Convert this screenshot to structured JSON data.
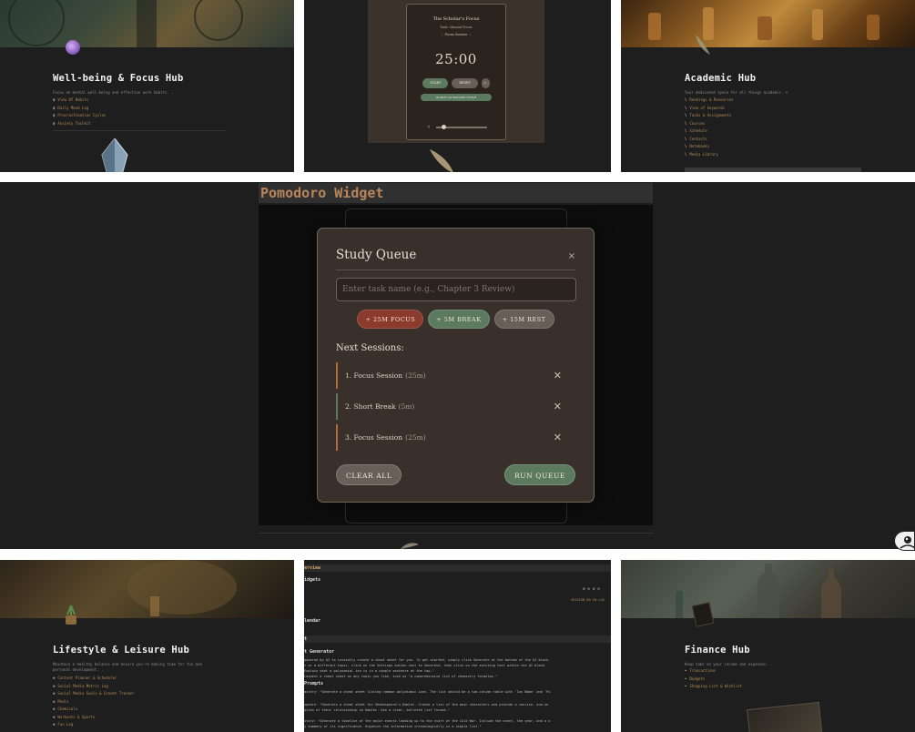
{
  "hubs": {
    "wellbeing": {
      "title": "Well-being & Focus Hub",
      "desc": "Focus on mental well-being and effective work habits. .",
      "items": [
        "View Of Habits",
        "Daily Mood Log",
        "Procrastination Cycles",
        "Anxiety Toolkit"
      ]
    },
    "academic": {
      "title": "Academic Hub",
      "desc": "Your dedicated space for all things academic. ☺",
      "items": [
        "Readings & Resources",
        "View of keywords",
        "Tasks & Assignments",
        "Courses",
        "Schedule",
        "Contacts",
        "Notebooks",
        "Media Library"
      ]
    },
    "lifestyle": {
      "title": "Lifestyle & Leisure Hub",
      "desc1": "Maintain a healthy balance and ensure you're making time for fun and",
      "desc2": "personal development. .",
      "items": [
        "Content Planner & Scheduler",
        "Social Media Metric Log",
        "Social Media Goals & Growth Tracker",
        "Meals",
        "Chemicals",
        "Workouts & Sports",
        "Fun Log"
      ]
    },
    "finance": {
      "title": "Finance Hub",
      "desc": "Keep tabs on your income and expenses. .",
      "items": [
        "Transactions",
        "Budgets",
        "Shopping List & Wishlist"
      ]
    }
  },
  "mini_timer": {
    "title": "The Scholar's Focus",
    "subtitle": "Task: Manual Focus",
    "mode": "Focus Session",
    "time": "25:00",
    "start": "START",
    "reset": "RESET",
    "queue": "QUEUE (0) MANAGE CYCLE"
  },
  "widget": {
    "title": "Pomodoro Widget"
  },
  "modal": {
    "title": "Study Queue",
    "close": "×",
    "input_placeholder": "Enter task name (e.g., Chapter 3 Review)",
    "add_focus": "+ 25M FOCUS",
    "add_break": "+ 5M BREAK",
    "add_rest": "+ 15M REST",
    "next_label": "Next Sessions:",
    "sessions": [
      {
        "label": "1. Focus Session",
        "duration": "(25m)",
        "kind": "focus"
      },
      {
        "label": "2. Short Break",
        "duration": "(5m)",
        "kind": "break"
      },
      {
        "label": "3. Focus Session",
        "duration": "(25m)",
        "kind": "focus"
      }
    ],
    "remove": "✕",
    "clear_all": "CLEAR ALL",
    "run_queue": "RUN QUEUE"
  },
  "docs": {
    "overview": "erview",
    "widgets": "idgets",
    "calendar": "lendar",
    "section": "t",
    "generator": "t Generator",
    "prompts": "Prompts",
    "line1": "powered by AI to instantly create a cheat sheet for you. To get started, simply click Generate at the bottom of the AI block.",
    "line2": "t or a different topic, click on the Settings button next to Generate, then click on the existing text within the AI block.",
    "line3": "Explain what a polynomial ion is in a simple sentence at the top.\"",
    "line4": "request a cheat sheet on any topic you like, such as \"a comprehensive list of chemistry formulas.\"",
    "line5": "mistry: \"Generate a cheat sheet listing common polyatomic ions. The list should be a two-column table with 'Ion Name' and 'Fo",
    "line6": "speare: \"Generate a cheat sheet for Shakespeare's Hamlet. Create a list of the main characters and provide a concise, one-se",
    "line7": "ption of their relationship to Hamlet. Use a clear, bulleted list format.\"",
    "line8": "story: \"Generate a timeline of the major events leading up to the start of the Cold War. Include the event, the year, and a o",
    "line9": "y summary of its significance. Organize the information chronologically in a simple list.\"",
    "icons_text": "⊕ ⊘ ⊗ ⊙",
    "small_right": "SESSION 00  IN  LOG"
  },
  "colors": {
    "accent_focus": "#8b3a2c",
    "accent_break": "#5c7a5f",
    "accent_rest": "#6a5e58",
    "link": "#b58a5a"
  }
}
